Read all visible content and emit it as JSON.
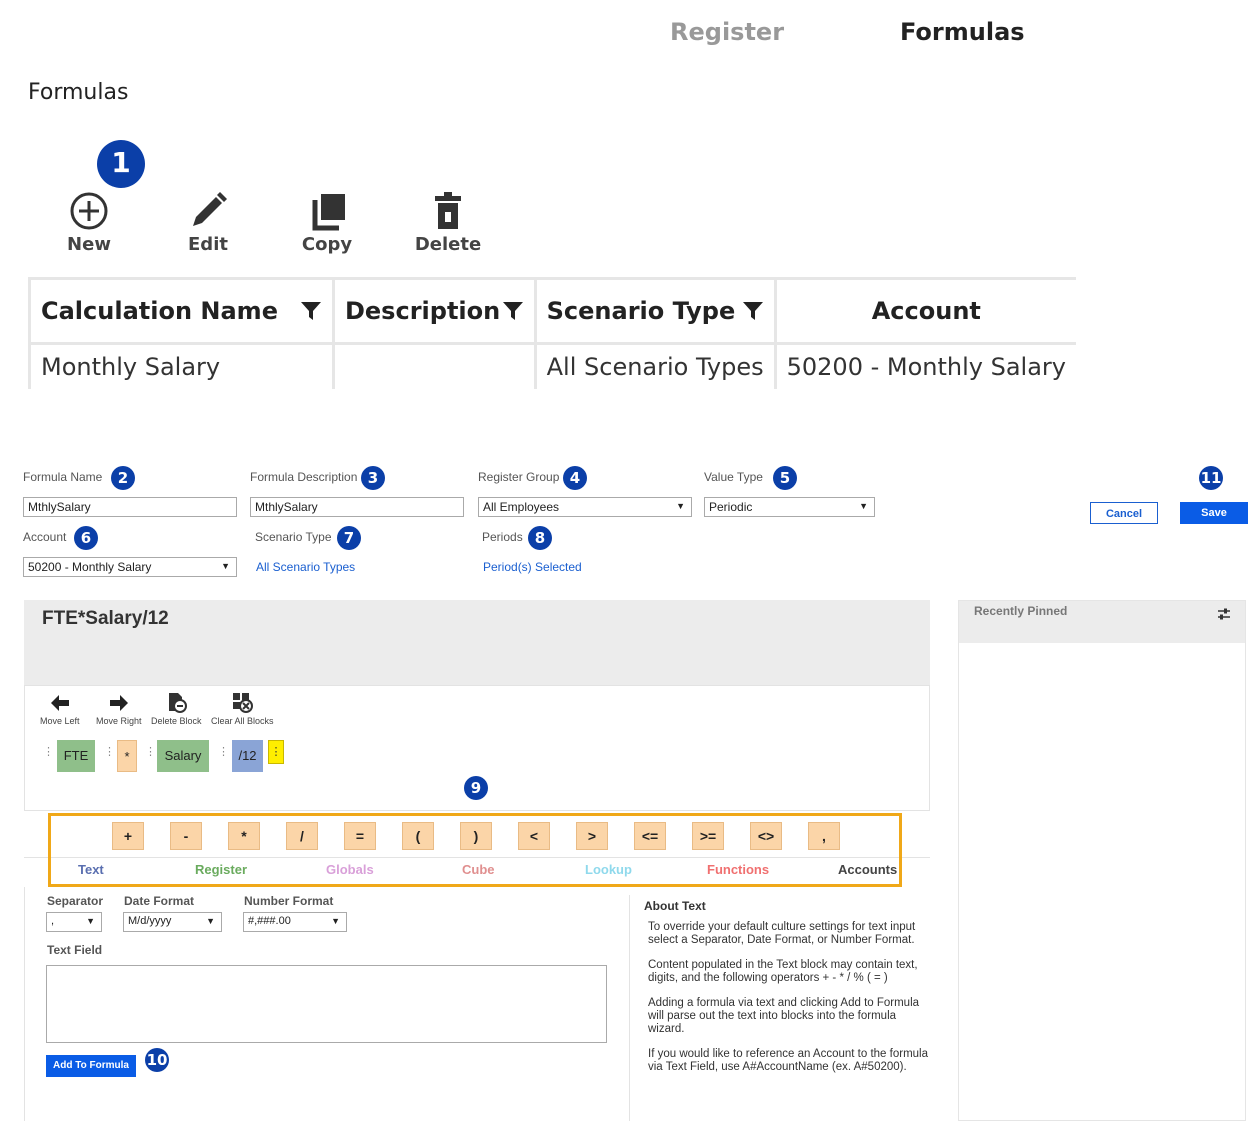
{
  "topnav": {
    "register": "Register",
    "formulas": "Formulas"
  },
  "page_title": "Formulas",
  "badges": {
    "b1": "1",
    "b2": "2",
    "b3": "3",
    "b4": "4",
    "b5": "5",
    "b6": "6",
    "b7": "7",
    "b8": "8",
    "b9": "9",
    "b10": "10",
    "b11": "11"
  },
  "toolbar": {
    "new": "New",
    "edit": "Edit",
    "copy": "Copy",
    "delete": "Delete"
  },
  "grid": {
    "headers": [
      "Calculation Name",
      "Description",
      "Scenario Type",
      "Account"
    ],
    "rows": [
      [
        "Monthly Salary",
        "",
        "All Scenario Types",
        "50200 - Monthly Salary"
      ]
    ]
  },
  "form": {
    "formula_name_label": "Formula Name",
    "formula_name_value": "MthlySalary",
    "formula_desc_label": "Formula Description",
    "formula_desc_value": "MthlySalary",
    "register_group_label": "Register Group",
    "register_group_value": "All Employees",
    "value_type_label": "Value Type",
    "value_type_value": "Periodic",
    "account_label": "Account",
    "account_value": "50200 - Monthly Salary",
    "scenario_type_label": "Scenario Type",
    "scenario_type_value": "All Scenario Types",
    "periods_label": "Periods",
    "periods_value": "Period(s) Selected",
    "cancel": "Cancel",
    "save": "Save"
  },
  "formula": {
    "expression": "FTE*Salary/12",
    "tools": {
      "move_left": "Move Left",
      "move_right": "Move Right",
      "delete_block": "Delete Block",
      "clear_all": "Clear All Blocks"
    },
    "blocks": {
      "b1": "FTE",
      "b2": "*",
      "b3": "Salary",
      "b4": "/12"
    }
  },
  "pinned": {
    "title": "Recently Pinned"
  },
  "operators": [
    "+",
    "-",
    "*",
    "/",
    "=",
    "(",
    ")",
    "<",
    ">",
    "<=",
    ">=",
    "<>",
    ","
  ],
  "tabs": {
    "text": "Text",
    "register": "Register",
    "globals": "Globals",
    "cube": "Cube",
    "lookup": "Lookup",
    "functions": "Functions",
    "accounts": "Accounts"
  },
  "tab_colors": {
    "text": "#5a6fb0",
    "register": "#6aab5e",
    "globals": "#d9a0d9",
    "cube": "#e08f8f",
    "lookup": "#8fd9ec",
    "functions": "#f07070",
    "accounts": "#444444"
  },
  "text_panel": {
    "separator_label": "Separator",
    "separator_value": ",",
    "date_format_label": "Date Format",
    "date_format_value": "M/d/yyyy",
    "number_format_label": "Number Format",
    "number_format_value": "#,###.00",
    "text_field_label": "Text Field",
    "add_button": "Add To Formula"
  },
  "about": {
    "title": "About Text",
    "p1": "To override your default culture settings for text input select a Separator, Date Format, or Number Format.",
    "p2": "Content populated in the Text block may contain text, digits, and the following operators + - * / % ( = )",
    "p3": "Adding a formula via text and clicking Add to Formula will parse out the text into blocks into the formula wizard.",
    "p4": "If you would like to reference an Account to the formula via Text Field, use A#AccountName (ex. A#50200)."
  }
}
